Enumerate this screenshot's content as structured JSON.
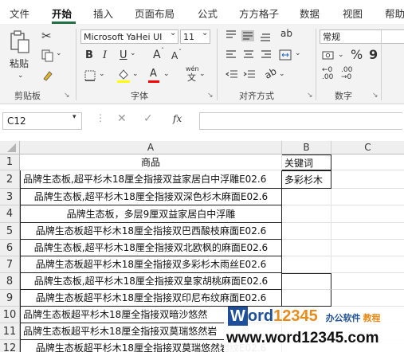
{
  "menu": {
    "tabs": [
      "文件",
      "开始",
      "插入",
      "页面布局",
      "公式",
      "方方格子",
      "数据",
      "视图",
      "帮助"
    ],
    "active": "开始"
  },
  "ribbon": {
    "clipboard": {
      "paste_label": "粘贴",
      "group_label": "剪贴板"
    },
    "font": {
      "font_name": "Microsoft YaHei UI",
      "font_size": "11",
      "bold": "B",
      "italic": "I",
      "underline": "U",
      "grow": "A",
      "shrink": "A",
      "fill_letter": "",
      "font_color_letter": "A",
      "phonetic": "wén",
      "group_label": "字体",
      "fill_color": "#ffff00",
      "font_color": "#ff0000"
    },
    "alignment": {
      "group_label": "对齐方式"
    },
    "number": {
      "format": "常规",
      "percent": "%",
      "comma": "9",
      "group_label": "数字"
    }
  },
  "formula_bar": {
    "name_box": "C12",
    "fx": "fx",
    "value": ""
  },
  "grid": {
    "columns": [
      "A",
      "B",
      "C"
    ],
    "rows": [
      {
        "num": "1",
        "a": "商品",
        "b": "关键词"
      },
      {
        "num": "2",
        "a": "品牌生态板,超平杉木18厘全指接双益家居白中浮雕E02.6",
        "b": "多彩杉木"
      },
      {
        "num": "3",
        "a": "品牌生态板,超平杉木18厘全指接双深色杉木麻面E02.6",
        "b": ""
      },
      {
        "num": "4",
        "a": "品牌生态板，多层9厘双益家居白中浮雕",
        "b": ""
      },
      {
        "num": "5",
        "a": "品牌生态板超平杉木18厘全指接双巴西酸枝麻面E02.6",
        "b": ""
      },
      {
        "num": "6",
        "a": "品牌生态板,超平杉木18厘全指接双北欧枫的麻面E02.6",
        "b": ""
      },
      {
        "num": "7",
        "a": "品牌生态板超平杉木18厘全指接双多彩杉木雨丝E02.6",
        "b": ""
      },
      {
        "num": "8",
        "a": "品牌生态板,超平杉木18厘全指接双皇家胡桃麻面E02.6",
        "b": ""
      },
      {
        "num": "9",
        "a": "品牌生态板超平杉木18厘全指接双印尼布纹麻面E02.6",
        "b": ""
      },
      {
        "num": "10",
        "a": "品牌生态板超平杉木18厘全指接双暗沙悠然",
        "b": ""
      },
      {
        "num": "11",
        "a": "品牌生态板超平杉木18厘全指接双莫瑞悠然岩",
        "b": ""
      },
      {
        "num": "12",
        "a": "品牌生态板超平杉木18厘全指接双莫瑞悠然岩纹E02.6",
        "b": ""
      }
    ]
  },
  "watermark": {
    "logo_w": "W",
    "logo_ord": "ord",
    "logo_num": "12345",
    "tagline_a": "办公软件",
    "tagline_b": "教程",
    "url": "www.word12345.com"
  }
}
